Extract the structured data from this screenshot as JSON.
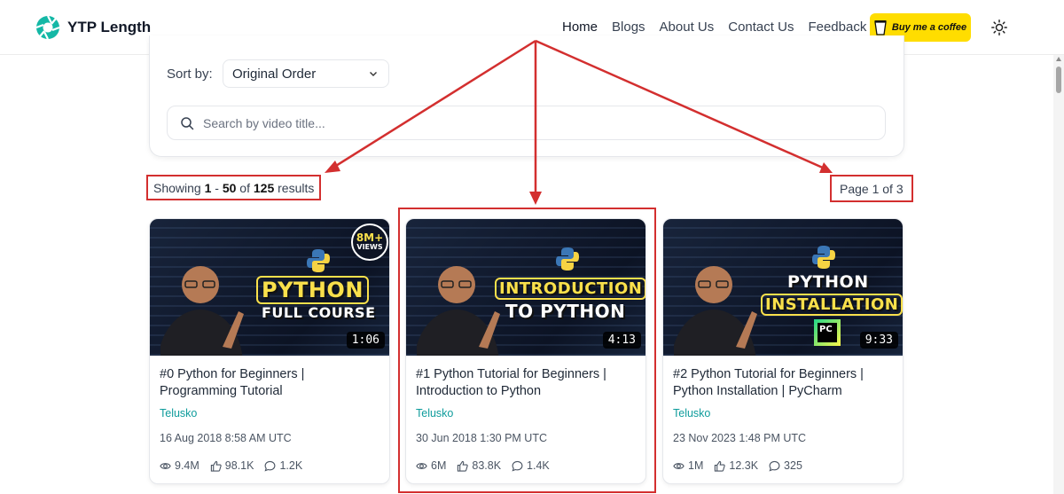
{
  "header": {
    "brand": "YTP Length",
    "nav": [
      {
        "label": "Home",
        "active": true
      },
      {
        "label": "Blogs"
      },
      {
        "label": "About Us"
      },
      {
        "label": "Contact Us"
      },
      {
        "label": "Feedback"
      }
    ],
    "coffee_label": "Buy me a coffee",
    "theme_icon": "sun-icon"
  },
  "filters": {
    "sort_label": "Sort by:",
    "sort_value": "Original Order",
    "search_placeholder": "Search by video title..."
  },
  "results": {
    "prefix": "Showing ",
    "from": "1",
    "dash": " - ",
    "to": "50",
    "of": " of ",
    "total": "125",
    "suffix": " results",
    "page_label": "Page 1 of 3"
  },
  "videos": [
    {
      "title": "#0 Python for Beginners | Programming Tutorial",
      "channel": "Telusko",
      "date": "16 Aug 2018 8:58 AM UTC",
      "views": "9.4M",
      "likes": "98.1K",
      "comments": "1.2K",
      "duration": "1:06",
      "thumb_line1": "PYTHON",
      "thumb_line2": "FULL COURSE",
      "badge_top": "8M+",
      "badge_bottom": "VIEWS"
    },
    {
      "title": "#1 Python Tutorial for Beginners | Introduction to Python",
      "channel": "Telusko",
      "date": "30 Jun 2018 1:30 PM UTC",
      "views": "6M",
      "likes": "83.8K",
      "comments": "1.4K",
      "duration": "4:13",
      "thumb_line1": "INTRODUCTION",
      "thumb_line2": "TO PYTHON"
    },
    {
      "title": "#2 Python Tutorial for Beginners | Python Installation | PyCharm",
      "channel": "Telusko",
      "date": "23 Nov 2023 1:48 PM UTC",
      "views": "1M",
      "likes": "12.3K",
      "comments": "325",
      "duration": "9:33",
      "thumb_line1": "PYTHON",
      "thumb_line2": "INSTALLATION",
      "badge_text": "PC"
    }
  ],
  "colors": {
    "accent_teal": "#0f9c9c",
    "coffee_yellow": "#ffdd00",
    "annotation_red": "#d32f2f"
  }
}
